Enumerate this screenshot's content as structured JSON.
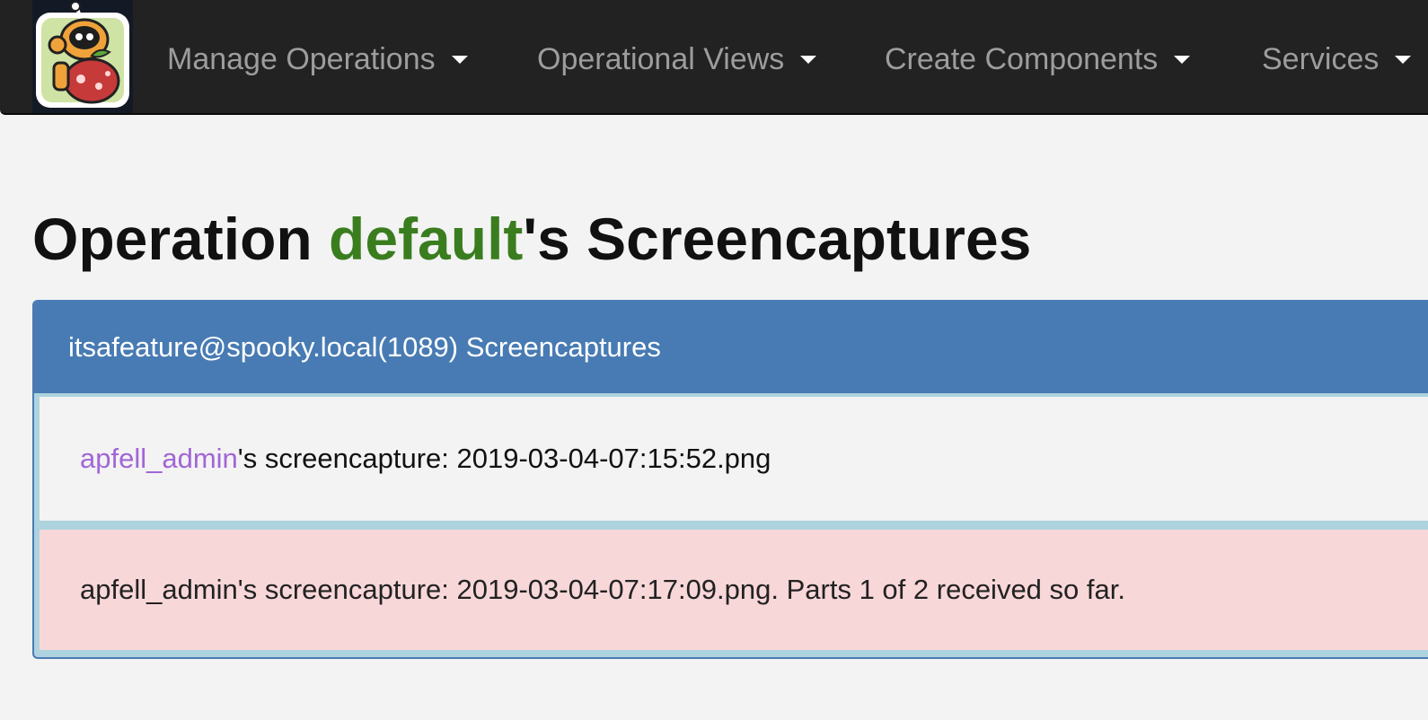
{
  "nav": {
    "items": [
      {
        "label": "Manage Operations"
      },
      {
        "label": "Operational Views"
      },
      {
        "label": "Create Components"
      },
      {
        "label": "Services"
      }
    ]
  },
  "page": {
    "title_prefix": "Operation ",
    "operation_name": "default",
    "title_suffix": "'s Screencaptures"
  },
  "panel": {
    "heading": "itsafeature@spooky.local(1089) Screencaptures",
    "entries": [
      {
        "user": "apfell_admin",
        "text": "'s screencapture: 2019-03-04-07:15:52.png",
        "status": "complete"
      },
      {
        "text": "apfell_admin's screencapture: 2019-03-04-07:17:09.png. Parts 1 of 2 received so far.",
        "status": "partial"
      }
    ]
  },
  "colors": {
    "navbar_bg": "#222222",
    "nav_text": "#9d9d9d",
    "operation_name": "#3a7d1f",
    "panel_heading_bg": "#487bb3",
    "user_link": "#a166d6",
    "partial_row_bg": "#f8d7d9"
  },
  "icons": {
    "logo": "apfell-robot-logo",
    "dropdown": "caret-down-icon"
  }
}
